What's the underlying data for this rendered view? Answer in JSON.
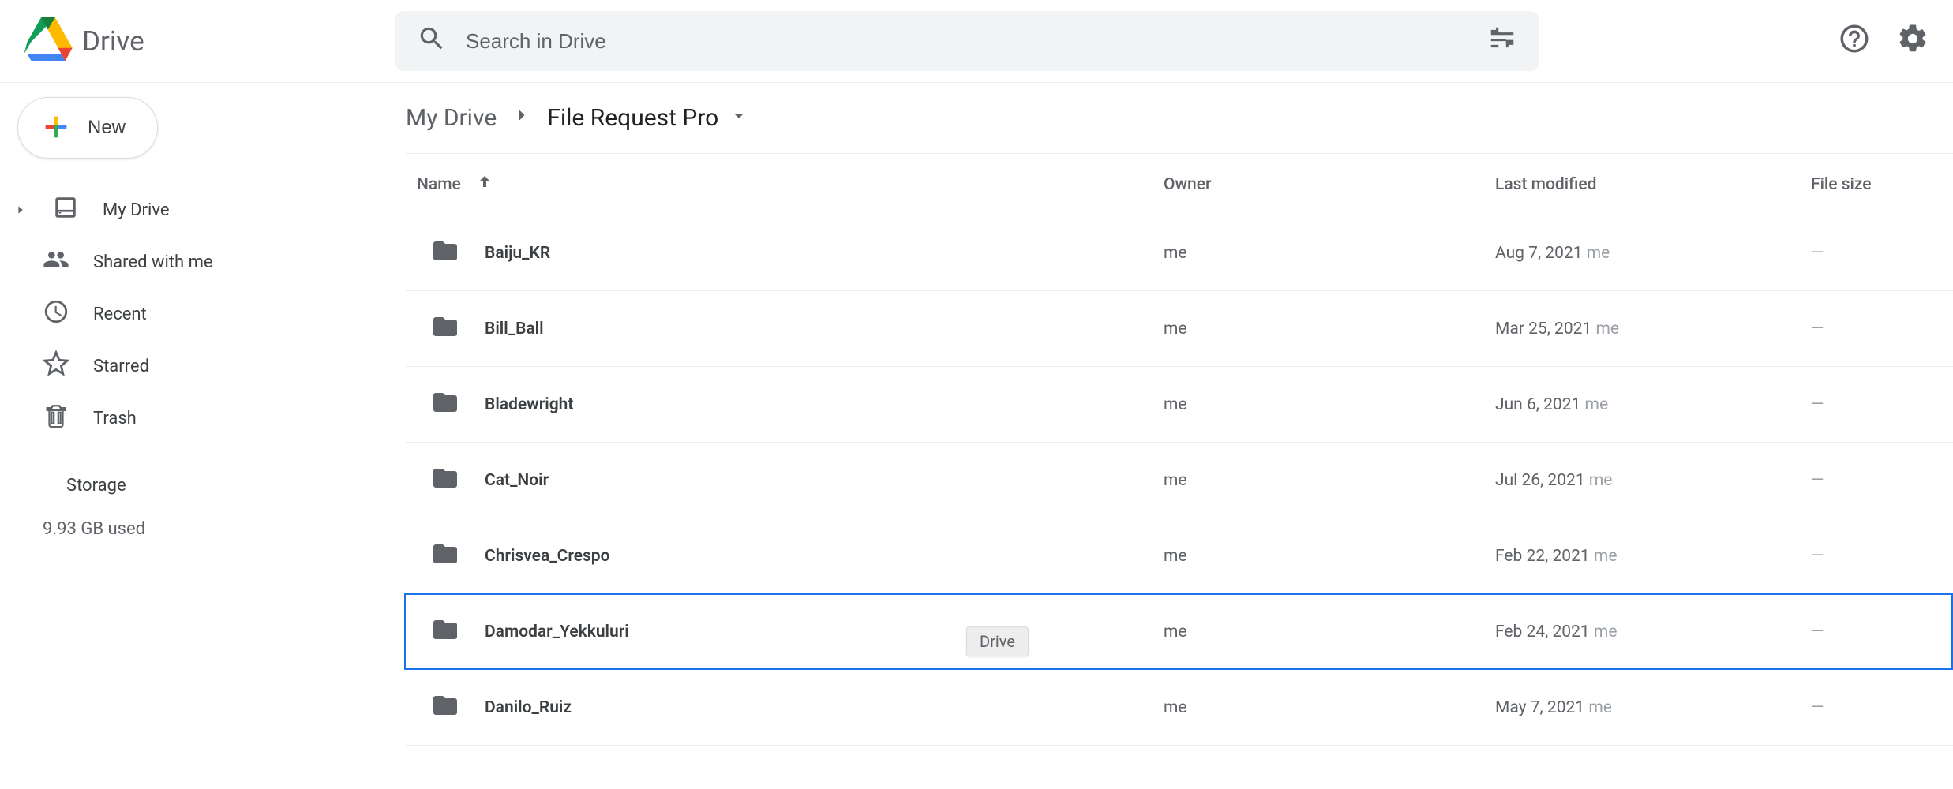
{
  "app_name": "Drive",
  "search_placeholder": "Search in Drive",
  "new_button": "New",
  "sidebar": {
    "items": [
      {
        "label": "My Drive"
      },
      {
        "label": "Shared with me"
      },
      {
        "label": "Recent"
      },
      {
        "label": "Starred"
      },
      {
        "label": "Trash"
      }
    ],
    "storage_label": "Storage",
    "storage_used": "9.93 GB used"
  },
  "breadcrumb": {
    "root": "My Drive",
    "current": "File Request Pro"
  },
  "columns": {
    "name": "Name",
    "owner": "Owner",
    "modified": "Last modified",
    "size": "File size"
  },
  "tooltip": "Drive",
  "rows": [
    {
      "name": "Baiju_KR",
      "owner": "me",
      "modified": "Aug 7, 2021",
      "mod_by": "me",
      "size": "—",
      "selected": false
    },
    {
      "name": "Bill_Ball",
      "owner": "me",
      "modified": "Mar 25, 2021",
      "mod_by": "me",
      "size": "—",
      "selected": false
    },
    {
      "name": "Bladewright",
      "owner": "me",
      "modified": "Jun 6, 2021",
      "mod_by": "me",
      "size": "—",
      "selected": false
    },
    {
      "name": "Cat_Noir",
      "owner": "me",
      "modified": "Jul 26, 2021",
      "mod_by": "me",
      "size": "—",
      "selected": false
    },
    {
      "name": "Chrisvea_Crespo",
      "owner": "me",
      "modified": "Feb 22, 2021",
      "mod_by": "me",
      "size": "—",
      "selected": false
    },
    {
      "name": "Damodar_Yekkuluri",
      "owner": "me",
      "modified": "Feb 24, 2021",
      "mod_by": "me",
      "size": "—",
      "selected": true
    },
    {
      "name": "Danilo_Ruiz",
      "owner": "me",
      "modified": "May 7, 2021",
      "mod_by": "me",
      "size": "—",
      "selected": false
    }
  ]
}
